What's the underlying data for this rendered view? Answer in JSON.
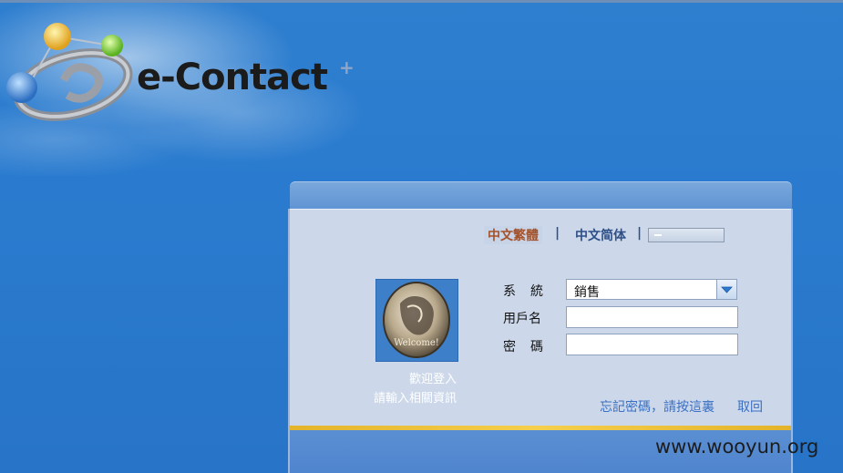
{
  "brand": {
    "name": "e-Contact",
    "plus": "+"
  },
  "language": {
    "traditional": "中文繁體",
    "separator": "|",
    "simplified": "中文简体"
  },
  "welcome": {
    "image_caption": "Welcome!",
    "line1": "歡迎登入",
    "line2": "請輸入相關資訊"
  },
  "form": {
    "system_label": "系統",
    "system_value": "銷售",
    "username_label": "用戶名",
    "username_value": "",
    "password_label": "密碼",
    "password_value": ""
  },
  "links": {
    "forgot": "忘記密碼，請按這裏",
    "retrieve": "取回"
  },
  "watermark": "www.wooyun.org",
  "colors": {
    "background": "#2a7bcf",
    "panel": "#ccd8ea",
    "link": "#3a6fc2",
    "traditional_lang": "#a5522a",
    "accent_gold": "#f5cf4e"
  }
}
